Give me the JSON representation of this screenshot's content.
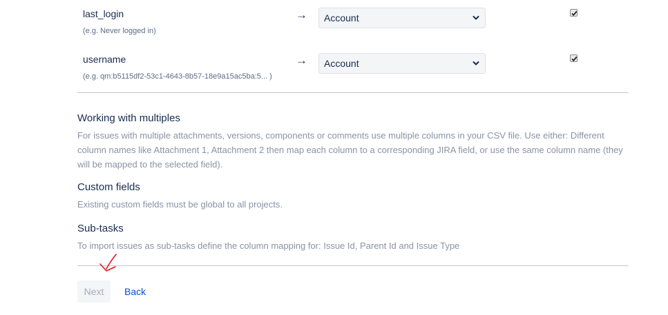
{
  "mappings": [
    {
      "field": "last_login",
      "example": "(e.g.  Never logged in)",
      "arrow": "→",
      "selected": "Account",
      "checked": true
    },
    {
      "field": "username",
      "example": "(e.g.  qm:b5115df2-53c1-4643-8b57-18e9a15ac5ba:5... )",
      "arrow": "→",
      "selected": "Account",
      "checked": true
    }
  ],
  "sections": [
    {
      "title": "Working with multiples",
      "text": "For issues with multiple attachments, versions, components or comments use multiple columns in your CSV file. Use either: Different column names like Attachment 1, Attachment 2 then map each column to a corresponding JIRA field, or use the same column name (they will be mapped to the selected field)."
    },
    {
      "title": "Custom fields",
      "text": "Existing custom fields must be global to all projects."
    },
    {
      "title": "Sub-tasks",
      "text": "To import issues as sub-tasks define the column mapping for: Issue Id, Parent Id and Issue Type"
    }
  ],
  "actions": {
    "next_label": "Next",
    "back_label": "Back"
  },
  "icons": {
    "dropdown": "chevron-down-icon",
    "checkbox": "checkmark-icon",
    "annotation": "red-arrow-annotation"
  },
  "colors": {
    "link": "#0052cc",
    "heading": "#172b4d",
    "muted_text": "#8993a4",
    "annotation": "#e8141b",
    "disabled_button_text": "#a5adba"
  }
}
